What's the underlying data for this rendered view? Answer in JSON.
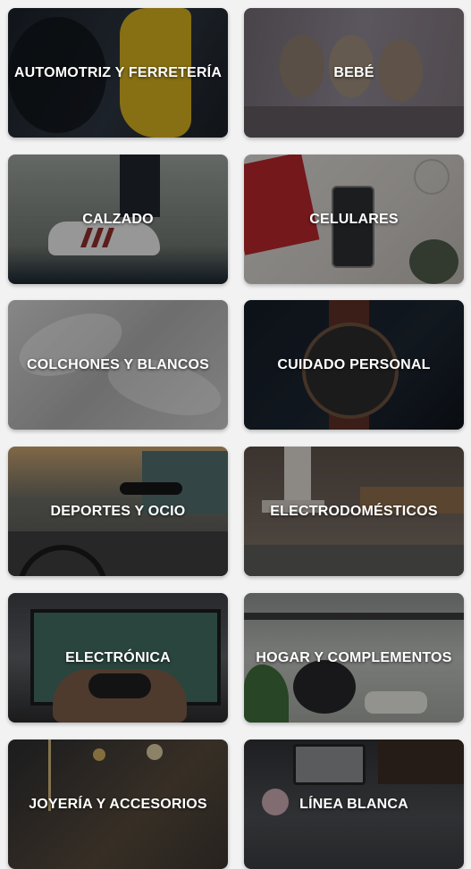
{
  "categories": [
    {
      "label": "AUTOMOTRIZ Y FERRETERÍA",
      "icon": "car-seat-image"
    },
    {
      "label": "BEBÉ",
      "icon": "teddy-bears-image"
    },
    {
      "label": "CALZADO",
      "icon": "sneaker-image"
    },
    {
      "label": "CELULARES",
      "icon": "smartphone-image"
    },
    {
      "label": "COLCHONES Y BLANCOS",
      "icon": "bedsheet-image"
    },
    {
      "label": "CUIDADO PERSONAL",
      "icon": "wristwatch-image"
    },
    {
      "label": "DEPORTES Y OCIO",
      "icon": "bicycle-image"
    },
    {
      "label": "ELECTRODOMÉSTICOS",
      "icon": "kitchen-image"
    },
    {
      "label": "ELECTRÓNICA",
      "icon": "game-controller-image"
    },
    {
      "label": "HOGAR Y COMPLEMENTOS",
      "icon": "kitchen-shelf-image"
    },
    {
      "label": "JOYERÍA Y ACCESORIOS",
      "icon": "jewelry-image"
    },
    {
      "label": "LÍNEA BLANCA",
      "icon": "appliance-image"
    }
  ]
}
